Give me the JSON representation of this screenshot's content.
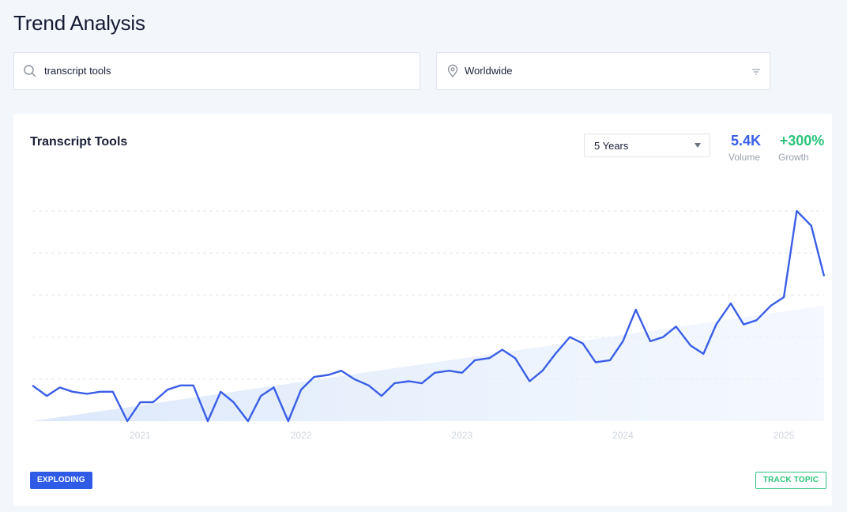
{
  "page": {
    "title": "Trend Analysis"
  },
  "search": {
    "value": "transcript tools"
  },
  "location": {
    "value": "Worldwide"
  },
  "card": {
    "title": "Transcript Tools",
    "range": "5 Years",
    "volume": {
      "value": "5.4K",
      "label": "Volume"
    },
    "growth": {
      "value": "+300%",
      "label": "Growth"
    },
    "badge": "EXPLODING",
    "track_label": "TRACK TOPIC"
  },
  "colors": {
    "line": "#3a5ee6",
    "volume": "#3a5ee6",
    "growth": "#2bc47a",
    "badge": "#2f5be6"
  },
  "chart_data": {
    "type": "line",
    "x_ticks": [
      "2021",
      "2022",
      "2023",
      "2024",
      "2025"
    ],
    "x_range": [
      2020.33,
      2025.25
    ],
    "y_range": [
      0,
      100
    ],
    "grid": true,
    "series": [
      {
        "x": [
          2020.33,
          2020.42,
          2020.5,
          2020.58,
          2020.67,
          2020.75,
          2020.83,
          2020.92,
          2021.0,
          2021.08,
          2021.17,
          2021.25,
          2021.33,
          2021.42,
          2021.5,
          2021.58,
          2021.67,
          2021.75,
          2021.83,
          2021.92,
          2022.0,
          2022.08,
          2022.17,
          2022.25,
          2022.33,
          2022.42,
          2022.5,
          2022.58,
          2022.67,
          2022.75,
          2022.83,
          2022.92,
          2023.0,
          2023.08,
          2023.17,
          2023.25,
          2023.33,
          2023.42,
          2023.5,
          2023.58,
          2023.67,
          2023.75,
          2023.83,
          2023.92,
          2024.0,
          2024.08,
          2024.17,
          2024.25,
          2024.33,
          2024.42,
          2024.5,
          2024.58,
          2024.67,
          2024.75,
          2024.83,
          2024.92,
          2025.0,
          2025.08,
          2025.17,
          2025.25
        ],
        "y": [
          17,
          12,
          16,
          14,
          13,
          14,
          14,
          0,
          9,
          9,
          15,
          17,
          17,
          0,
          14,
          9,
          0,
          12,
          16,
          0,
          15,
          21,
          22,
          24,
          20,
          17,
          12,
          18,
          19,
          18,
          23,
          24,
          23,
          29,
          30,
          34,
          30,
          19,
          24,
          32,
          40,
          37,
          28,
          29,
          38,
          53,
          38,
          40,
          45,
          36,
          32,
          46,
          56,
          46,
          48,
          55,
          59,
          100,
          93,
          69
        ]
      }
    ]
  }
}
